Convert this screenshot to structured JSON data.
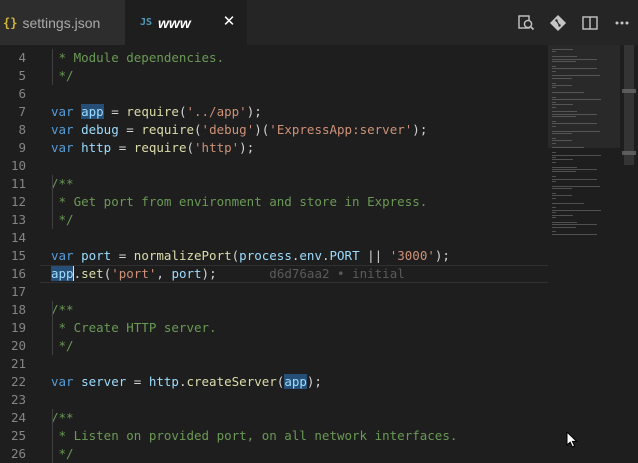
{
  "tabs": [
    {
      "icon": "{}",
      "label": "settings.json",
      "active": false
    },
    {
      "icon": "JS",
      "label": "www",
      "active": true,
      "close": "✕"
    }
  ],
  "editor": {
    "current_line": 16,
    "blame": "d6d76aa2 • initial",
    "lines": [
      {
        "n": "4",
        "tokens": [
          [
            "c",
            " * Module dependencies."
          ]
        ]
      },
      {
        "n": "5",
        "tokens": [
          [
            "c",
            " */"
          ]
        ]
      },
      {
        "n": "6",
        "tokens": []
      },
      {
        "n": "7",
        "tokens": [
          [
            "k",
            "var "
          ],
          [
            "vh",
            "app"
          ],
          [
            "p",
            " = "
          ],
          [
            "f",
            "require"
          ],
          [
            "p",
            "("
          ],
          [
            "s",
            "'../app'"
          ],
          [
            "p",
            ");"
          ]
        ]
      },
      {
        "n": "8",
        "tokens": [
          [
            "k",
            "var "
          ],
          [
            "v",
            "debug"
          ],
          [
            "p",
            " = "
          ],
          [
            "f",
            "require"
          ],
          [
            "p",
            "("
          ],
          [
            "s",
            "'debug'"
          ],
          [
            "p",
            ")("
          ],
          [
            "s",
            "'ExpressApp:server'"
          ],
          [
            "p",
            ");"
          ]
        ]
      },
      {
        "n": "9",
        "tokens": [
          [
            "k",
            "var "
          ],
          [
            "v",
            "http"
          ],
          [
            "p",
            " = "
          ],
          [
            "f",
            "require"
          ],
          [
            "p",
            "("
          ],
          [
            "s",
            "'http'"
          ],
          [
            "p",
            ");"
          ]
        ]
      },
      {
        "n": "10",
        "tokens": []
      },
      {
        "n": "11",
        "tokens": [
          [
            "c",
            "/**"
          ]
        ]
      },
      {
        "n": "12",
        "tokens": [
          [
            "c",
            " * Get port from environment and store in Express."
          ]
        ]
      },
      {
        "n": "13",
        "tokens": [
          [
            "c",
            " */"
          ]
        ]
      },
      {
        "n": "14",
        "tokens": []
      },
      {
        "n": "15",
        "tokens": [
          [
            "k",
            "var "
          ],
          [
            "v",
            "port"
          ],
          [
            "p",
            " = "
          ],
          [
            "f",
            "normalizePort"
          ],
          [
            "p",
            "("
          ],
          [
            "v",
            "process"
          ],
          [
            "p",
            "."
          ],
          [
            "v",
            "env"
          ],
          [
            "p",
            "."
          ],
          [
            "v",
            "PORT"
          ],
          [
            "p",
            " || "
          ],
          [
            "s",
            "'3000'"
          ],
          [
            "p",
            ");"
          ]
        ]
      },
      {
        "n": "16",
        "tokens": [
          [
            "vh",
            "app"
          ],
          [
            "caret",
            ""
          ],
          [
            "p",
            "."
          ],
          [
            "f",
            "set"
          ],
          [
            "p",
            "("
          ],
          [
            "s",
            "'port'"
          ],
          [
            "p",
            ", "
          ],
          [
            "v",
            "port"
          ],
          [
            "p",
            ");"
          ]
        ]
      },
      {
        "n": "17",
        "tokens": []
      },
      {
        "n": "18",
        "tokens": [
          [
            "c",
            "/**"
          ]
        ]
      },
      {
        "n": "19",
        "tokens": [
          [
            "c",
            " * Create HTTP server."
          ]
        ]
      },
      {
        "n": "20",
        "tokens": [
          [
            "c",
            " */"
          ]
        ]
      },
      {
        "n": "21",
        "tokens": []
      },
      {
        "n": "22",
        "tokens": [
          [
            "k",
            "var "
          ],
          [
            "v",
            "server"
          ],
          [
            "p",
            " = "
          ],
          [
            "v",
            "http"
          ],
          [
            "p",
            "."
          ],
          [
            "f",
            "createServer"
          ],
          [
            "p",
            "("
          ],
          [
            "vh",
            "app"
          ],
          [
            "p",
            ");"
          ]
        ]
      },
      {
        "n": "23",
        "tokens": []
      },
      {
        "n": "24",
        "tokens": [
          [
            "c",
            "/**"
          ]
        ]
      },
      {
        "n": "25",
        "tokens": [
          [
            "c",
            " * Listen on provided port, on all network interfaces."
          ]
        ]
      },
      {
        "n": "26",
        "tokens": [
          [
            "c",
            " */"
          ]
        ]
      }
    ]
  },
  "colors": {
    "background": "#1e1e1e",
    "keyword": "#569cd6",
    "variable": "#9cdcfe",
    "function": "#dcdcaa",
    "string": "#ce9178",
    "comment": "#6a9955",
    "selection": "#264f78"
  },
  "icons": [
    "open-changes-icon",
    "git-commit-icon",
    "split-editor-icon",
    "more-actions-icon",
    "mouse-pointer-icon"
  ]
}
